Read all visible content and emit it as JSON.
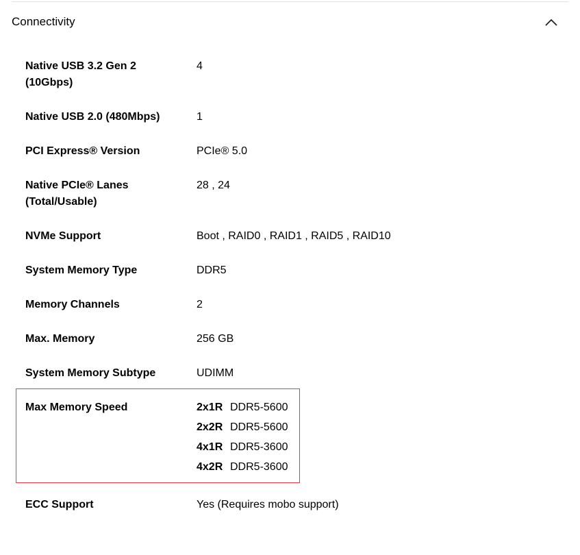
{
  "section": {
    "title": "Connectivity",
    "toggle_icon": "chevron-up-icon"
  },
  "specs": [
    {
      "label": "Native USB 3.2 Gen 2 (10Gbps)",
      "value": "4"
    },
    {
      "label": "Native USB 2.0 (480Mbps)",
      "value": "1"
    },
    {
      "label": "PCI Express® Version",
      "value": "PCIe® 5.0"
    },
    {
      "label": "Native PCIe® Lanes (Total/Usable)",
      "value": "28 , 24"
    },
    {
      "label": "NVMe Support",
      "value": "Boot , RAID0 , RAID1 , RAID5 , RAID10"
    },
    {
      "label": "System Memory Type",
      "value": "DDR5"
    },
    {
      "label": "Memory Channels",
      "value": "2"
    },
    {
      "label": "Max. Memory",
      "value": "256 GB"
    },
    {
      "label": "System Memory Subtype",
      "value": "UDIMM"
    }
  ],
  "max_memory_speed": {
    "label": "Max Memory Speed",
    "entries": [
      {
        "config": "2x1R",
        "speed": "DDR5-5600"
      },
      {
        "config": "2x2R",
        "speed": "DDR5-5600"
      },
      {
        "config": "4x1R",
        "speed": "DDR5-3600"
      },
      {
        "config": "4x2R",
        "speed": "DDR5-3600"
      }
    ],
    "highlight_color": "#e0404a"
  },
  "ecc": {
    "label": "ECC Support",
    "value": "Yes (Requires mobo support)"
  }
}
